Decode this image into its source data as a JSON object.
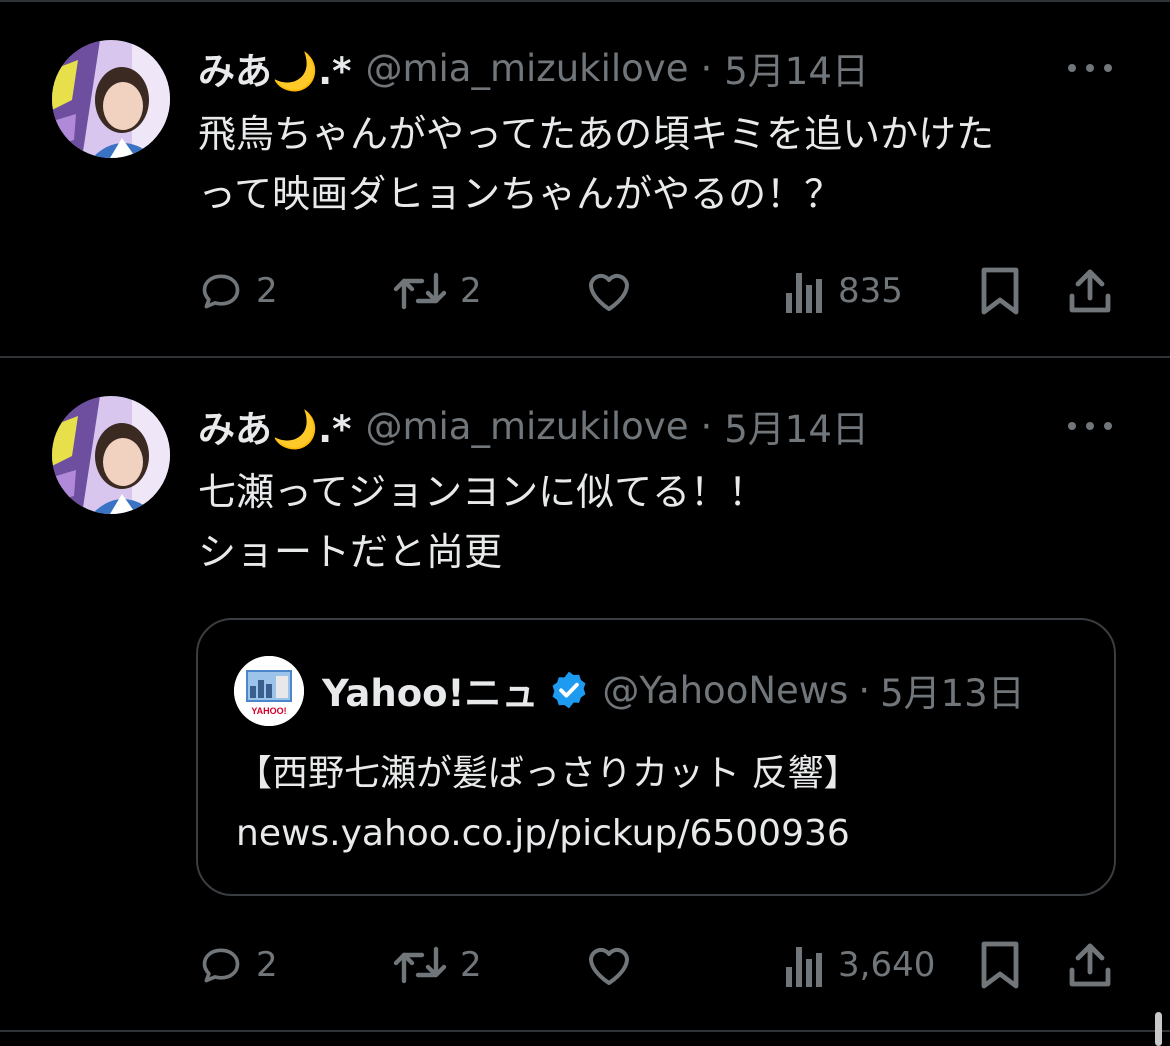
{
  "tweets": [
    {
      "name": "みあ🌙.*",
      "handle": "@mia_mizukilove",
      "dot": "·",
      "date": "5月14日",
      "lines": [
        "飛鳥ちゃんがやってたあの頃キミを追いかけた",
        "って映画ダヒョンちゃんがやるの！？"
      ],
      "replies": "2",
      "retweets": "2",
      "views": "835"
    },
    {
      "name": "みあ🌙.*",
      "handle": "@mia_mizukilove",
      "dot": "·",
      "date": "5月14日",
      "lines": [
        "七瀬ってジョンヨンに似てる！！",
        "ショートだと尚更"
      ],
      "quote": {
        "name": "Yahoo!ニュ",
        "handle": "@YahooNews",
        "dot": "·",
        "date": "5月13日",
        "avatar_text": "YAHOO!",
        "lines": [
          "【西野七瀬が髪ばっさりカット 反響】",
          "news.yahoo.co.jp/pickup/6500936"
        ]
      },
      "replies": "2",
      "retweets": "2",
      "views": "3,640"
    }
  ],
  "colors": {
    "background": "#000000",
    "text": "#e7e9ea",
    "muted": "#71767b",
    "divider": "#2f3336",
    "verified": "#1d9bf0"
  },
  "icons": [
    "reply-icon",
    "retweet-icon",
    "like-icon",
    "views-icon",
    "bookmark-icon",
    "share-icon",
    "more-icon",
    "verified-icon",
    "moon-icon"
  ]
}
